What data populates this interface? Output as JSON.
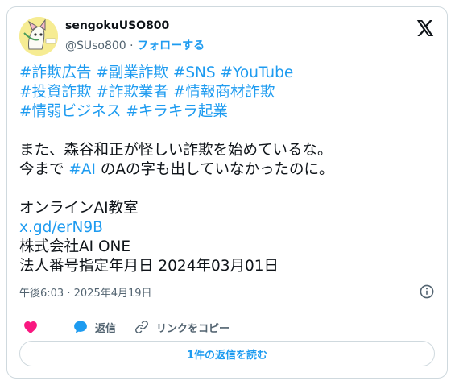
{
  "user": {
    "display_name": "sengokuUSO800",
    "handle": "@SUso800",
    "separator": "·",
    "follow_label": "フォローする"
  },
  "post": {
    "hashtags": [
      [
        "#詐欺広告",
        "#副業詐欺",
        "#SNS",
        "#YouTube"
      ],
      [
        "#投資詐欺",
        "#詐欺業者",
        "#情報商材詐欺"
      ],
      [
        "#情弱ビジネス",
        "#キラキラ起業"
      ]
    ],
    "line1": "また、森谷和正が怪しい詐欺を始めているな。",
    "line2_before": "今まで ",
    "line2_tag": "#AI",
    "line2_after": " のAの字も出していなかったのに。",
    "school": "オンラインAI教室",
    "link": "x.gd/erN9B",
    "company": "株式会社AI ONE",
    "corp_number_date": "法人番号指定年月日 2024年03月01日"
  },
  "meta": {
    "time": "午後6:03",
    "separator": "·",
    "date": "2025年4月19日"
  },
  "actions": {
    "reply_label": "返信",
    "copy_link_label": "リンクをコピー",
    "read_replies_label": "1件の返信を読む"
  },
  "colors": {
    "accent": "#1d9bf0",
    "like": "#f91880",
    "text": "#0f1419",
    "muted": "#536471",
    "border": "#cfd9de"
  },
  "icons": [
    "x-logo-icon",
    "info-icon",
    "heart-icon",
    "reply-bubble-icon",
    "link-icon"
  ]
}
